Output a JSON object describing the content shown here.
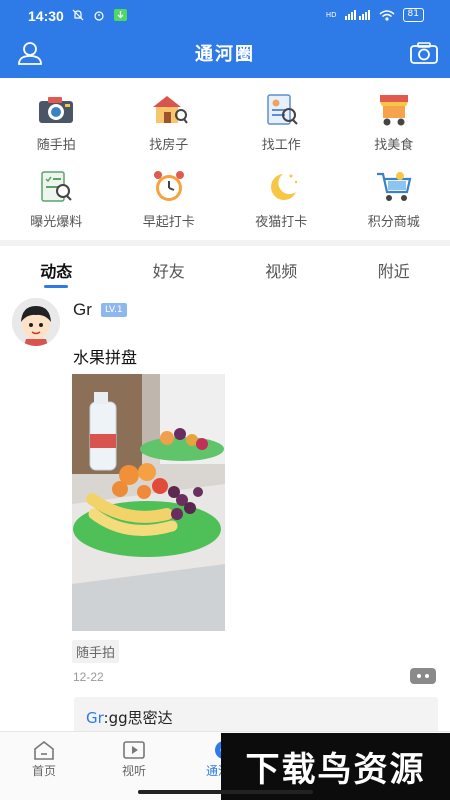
{
  "status_bar": {
    "time": "14:30",
    "left_icons": [
      "mute-icon",
      "alarm-icon",
      "download-icon"
    ],
    "signal": "HD",
    "battery": "81"
  },
  "header": {
    "title": "通河圈",
    "left_icon": "user-icon",
    "right_icon": "camera-icon",
    "bg_color": "#2e7be8"
  },
  "categories": [
    {
      "label": "随手拍",
      "icon": "camera-icon"
    },
    {
      "label": "找房子",
      "icon": "house-search-icon"
    },
    {
      "label": "找工作",
      "icon": "resume-icon"
    },
    {
      "label": "找美食",
      "icon": "food-cart-icon"
    },
    {
      "label": "曝光爆料",
      "icon": "report-icon"
    },
    {
      "label": "早起打卡",
      "icon": "alarm-clock-icon"
    },
    {
      "label": "夜猫打卡",
      "icon": "moon-icon"
    },
    {
      "label": "积分商城",
      "icon": "shopping-cart-icon"
    }
  ],
  "tabs": [
    {
      "label": "动态",
      "active": true
    },
    {
      "label": "好友",
      "active": false
    },
    {
      "label": "视频",
      "active": false
    },
    {
      "label": "附近",
      "active": false
    }
  ],
  "post": {
    "username": "Gr",
    "level": "LV.1",
    "text": "水果拼盘",
    "tag": "随手拍",
    "date": "12-22",
    "comment_user": "Gr",
    "comment_text": ":gg思密达"
  },
  "bottom_nav": [
    {
      "label": "首页",
      "icon": "home-icon",
      "active": false
    },
    {
      "label": "视听",
      "icon": "video-icon",
      "active": false
    },
    {
      "label": "通河圈",
      "icon": "circle-icon",
      "active": true
    }
  ],
  "watermark": "下载鸟资源"
}
